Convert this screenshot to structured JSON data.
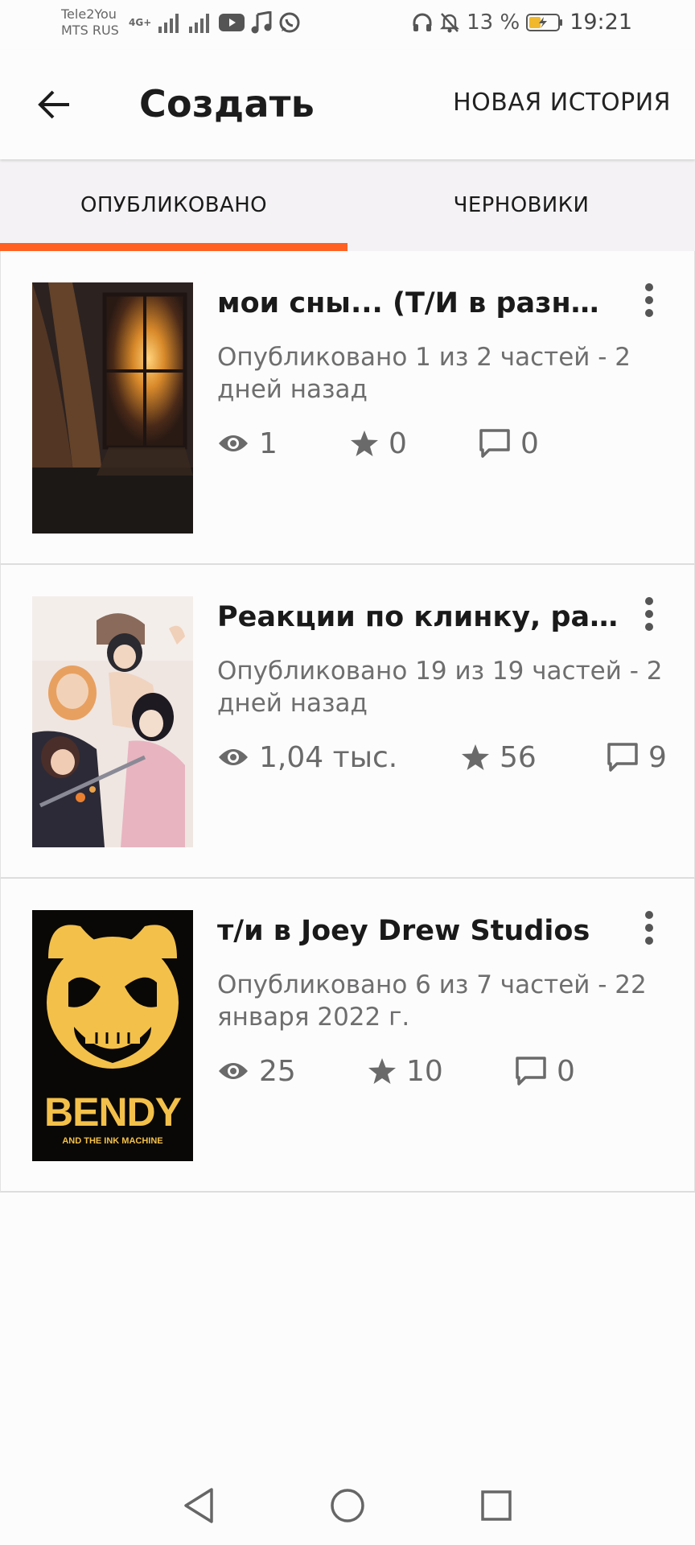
{
  "status_bar": {
    "carrier1": "Tele2You",
    "carrier2": "MTS RUS",
    "network": "4G+",
    "battery": "13 %",
    "time": "19:21",
    "icons": [
      "signal-icon",
      "youtube-icon",
      "music-icon",
      "whatsapp-icon",
      "headphones-icon",
      "bell-off-icon",
      "battery-icon"
    ]
  },
  "app_bar": {
    "back_icon": "arrow-left-icon",
    "title": "Создать",
    "action": "НОВАЯ ИСТОРИЯ"
  },
  "tabs": [
    {
      "label": "ОПУБЛИКОВАНО",
      "selected": true
    },
    {
      "label": "ЧЕРНОВИКИ",
      "selected": false
    }
  ],
  "accent_color": "#ff6122",
  "stories": [
    {
      "title": "мои сны... (Т/И в разных мирах)",
      "meta": "Опубликовано 1 из 2 частей - 2 дней назад",
      "views": "1",
      "votes": "0",
      "comments": "0",
      "cover": "window-sunset-cover"
    },
    {
      "title": "Реакции по клинку, рассекающему демонов",
      "meta": "Опубликовано 19 из 19 частей - 2 дней назад",
      "views": "1,04 тыс.",
      "votes": "56",
      "comments": "9",
      "cover": "anime-group-cover"
    },
    {
      "title": "т/и в Joey Drew Studios",
      "meta": "Опубликовано 6 из 7 частей - 22 января 2022 г.",
      "views": "25",
      "votes": "10",
      "comments": "0",
      "cover": "bendy-cover"
    }
  ],
  "covers": {
    "bendy_logo": "BENDY",
    "bendy_sub": "AND THE INK MACHINE"
  },
  "nav_bar": [
    "back-triangle-icon",
    "home-circle-icon",
    "recents-square-icon"
  ]
}
